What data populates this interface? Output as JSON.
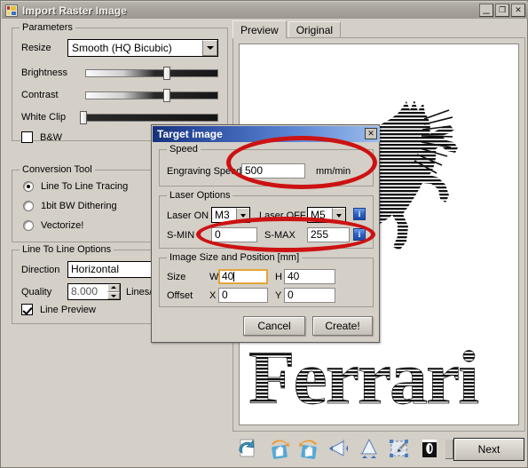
{
  "window": {
    "title": "Import Raster Image",
    "icon": "app-grid-icon",
    "buttons": {
      "minimize": "_",
      "maximize": "❐",
      "close": "✕"
    }
  },
  "parameters": {
    "group_title": "Parameters",
    "resize_label": "Resize",
    "resize_value": "Smooth (HQ Bicubic)",
    "brightness_label": "Brightness",
    "brightness_pct": 62,
    "contrast_label": "Contrast",
    "contrast_pct": 62,
    "white_clip_label": "White Clip",
    "white_clip_pct": 0,
    "bw_label": "B&W",
    "bw_checked": false
  },
  "conversion": {
    "group_title": "Conversion Tool",
    "options": [
      {
        "label": "Line To Line Tracing",
        "selected": true
      },
      {
        "label": "1bit BW Dithering",
        "selected": false
      },
      {
        "label": "Vectorize!",
        "selected": false
      }
    ]
  },
  "line_options": {
    "group_title": "Line To Line Options",
    "direction_label": "Direction",
    "direction_value": "Horizontal",
    "quality_label": "Quality",
    "quality_value": "8.000",
    "quality_units": "Lines/m",
    "line_preview_label": "Line Preview",
    "line_preview_checked": true
  },
  "preview": {
    "tabs": [
      {
        "label": "Preview",
        "active": true
      },
      {
        "label": "Original",
        "active": false
      }
    ],
    "artwork": "ferrari-prancing-horse-line-traced"
  },
  "target_dialog": {
    "title": "Target image",
    "close_label": "✕",
    "speed": {
      "group_title": "Speed",
      "engraving_speed_label": "Engraving Speed",
      "engraving_speed_value": "500",
      "units": "mm/min"
    },
    "laser": {
      "group_title": "Laser Options",
      "laser_on_label": "Laser ON",
      "laser_on_value": "M3",
      "laser_off_label": "Laser OFF",
      "laser_off_value": "M5",
      "s_min_label": "S-MIN",
      "s_min_value": "0",
      "s_max_label": "S-MAX",
      "s_max_value": "255",
      "info_label": "i"
    },
    "size": {
      "group_title": "Image Size and Position [mm]",
      "size_label": "Size",
      "width_prefix": "W",
      "width_value": "40",
      "height_prefix": "H",
      "height_value": "40",
      "offset_label": "Offset",
      "x_prefix": "X",
      "x_value": "0",
      "y_prefix": "Y",
      "y_value": "0"
    },
    "cancel_label": "Cancel",
    "create_label": "Create!"
  },
  "annotations": {
    "ellipse_color": "#cc1212",
    "items": [
      {
        "name": "engraving-speed-highlight"
      },
      {
        "name": "smin-smax-highlight"
      }
    ]
  },
  "toolbar": {
    "icons": [
      "undo-arrow-icon",
      "rotate-left-icon",
      "rotate-right-icon",
      "flip-horizontal-icon",
      "flip-vertical-icon",
      "crop-icon",
      "invert-colors-icon"
    ],
    "next_label": "Next"
  }
}
